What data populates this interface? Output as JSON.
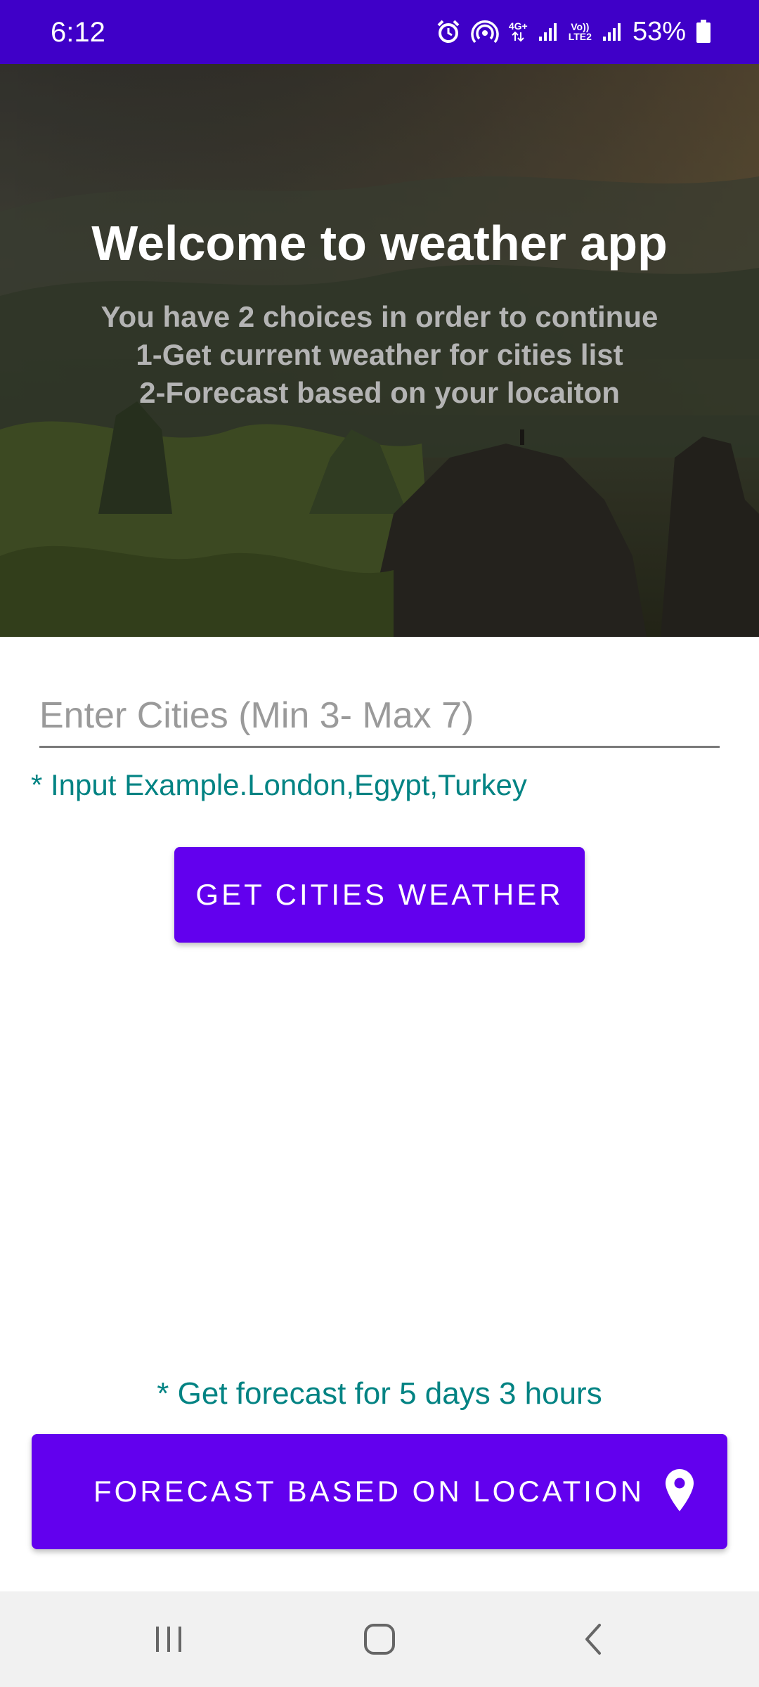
{
  "status_bar": {
    "time": "6:12",
    "network_label_top": "4G+",
    "volte_label_top": "Vo))",
    "volte_label_bottom": "LTE2",
    "battery": "53%"
  },
  "hero": {
    "title": "Welcome to weather app",
    "subtitle_lines": [
      "You have 2 choices in order to continue",
      "1-Get current weather for cities list",
      "2-Forecast based on your locaiton"
    ]
  },
  "cities_form": {
    "input_placeholder": "Enter Cities (Min 3- Max 7)",
    "input_value": "",
    "example_hint": "* Input Example.London,Egypt,Turkey",
    "button_label": "GET CITIES WEATHER"
  },
  "forecast": {
    "hint": "* Get forecast for 5 days 3 hours",
    "button_label": "FORECAST BASED ON LOCATION",
    "button_icon": "location-pin-icon"
  },
  "nav_bar": {
    "icons": [
      "recent-apps-icon",
      "home-icon",
      "back-icon"
    ]
  },
  "colors": {
    "status_bar": "#3f00c8",
    "primary_button": "#6200ee",
    "hint_text": "#028383",
    "nav_bar": "#f1f1f1"
  }
}
